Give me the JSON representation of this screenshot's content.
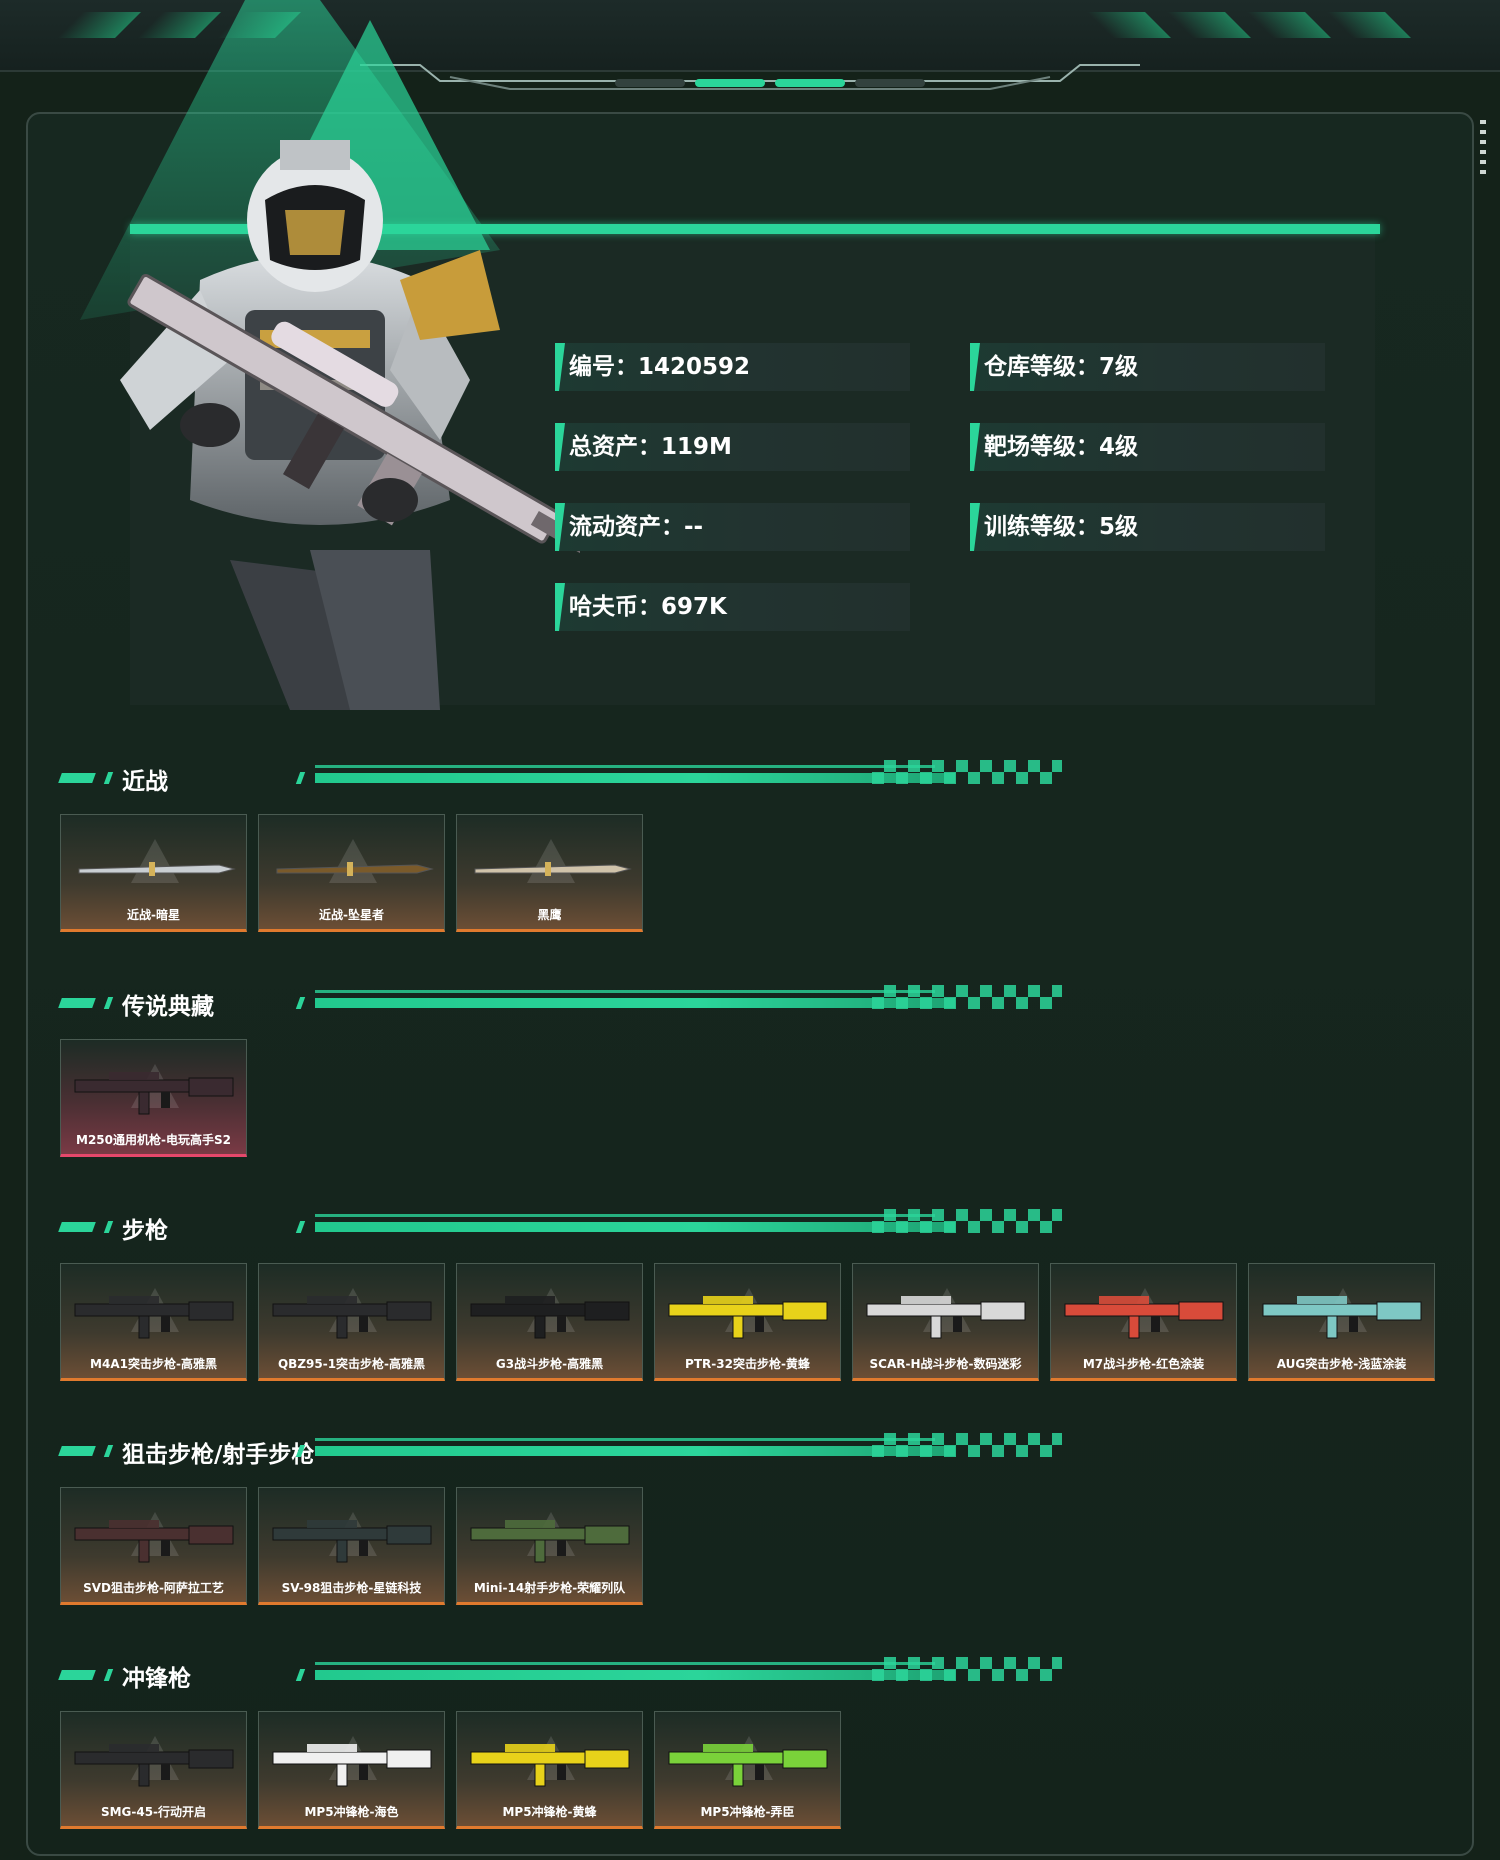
{
  "profile": {
    "stats_left": [
      {
        "label": "编号：1420592"
      },
      {
        "label": "总资产：119M"
      },
      {
        "label": "流动资产：--"
      },
      {
        "label": "哈夫币：697K"
      }
    ],
    "stats_right": [
      {
        "label": "仓库等级：7级"
      },
      {
        "label": "靶场等级：4级"
      },
      {
        "label": "训练等级：5级"
      }
    ]
  },
  "sections": [
    {
      "title": "近战",
      "items": [
        "近战-暗星",
        "近战-坠星者",
        "黑鹰"
      ]
    },
    {
      "title": "传说典藏",
      "items": [
        "M250通用机枪-电玩高手S2"
      ]
    },
    {
      "title": "步枪",
      "items": [
        "M4A1突击步枪-高雅黑",
        "QBZ95-1突击步枪-高雅黑",
        "G3战斗步枪-高雅黑",
        "PTR-32突击步枪-黄蜂",
        "SCAR-H战斗步枪-数码迷彩",
        "M7战斗步枪-红色涂装",
        "AUG突击步枪-浅蓝涂装"
      ]
    },
    {
      "title": "狙击步枪/射手步枪",
      "items": [
        "SVD狙击步枪-阿萨拉工艺",
        "SV-98狙击步枪-星链科技",
        "Mini-14射手步枪-荣耀列队"
      ]
    },
    {
      "title": "冲锋枪",
      "items": [
        "SMG-45-行动开启",
        "MP5冲锋枪-海色",
        "MP5冲锋枪-黄蜂",
        "MP5冲锋枪-弄臣"
      ]
    }
  ],
  "colors": {
    "accent": "#2bd59a",
    "card_border_orange": "#e07a2e",
    "card_border_red": "#e5486b",
    "background": "#142219"
  }
}
